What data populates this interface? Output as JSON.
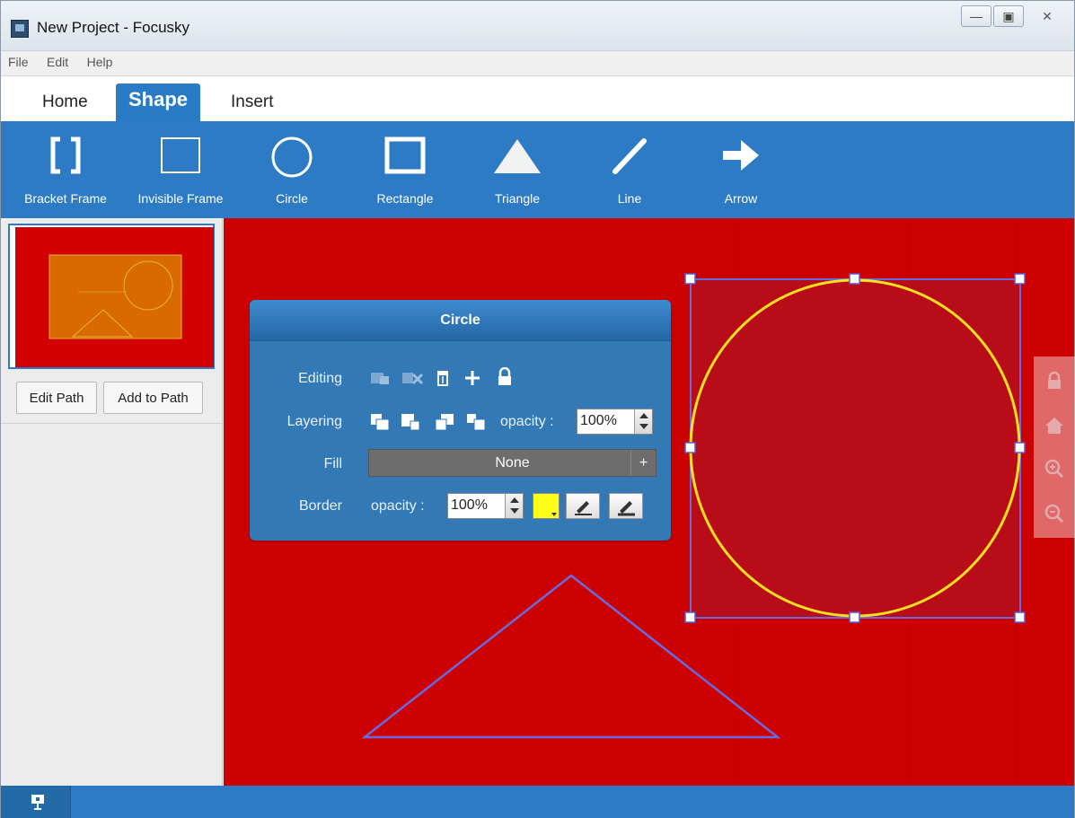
{
  "window": {
    "title": "New Project - Focusky",
    "controls": [
      "minimize-icon",
      "restore-icon",
      "close-icon"
    ]
  },
  "menu": [
    "File",
    "Edit",
    "Help"
  ],
  "tabs": [
    {
      "label": "Home",
      "active": false
    },
    {
      "label": "Shape",
      "active": true
    },
    {
      "label": "Insert",
      "active": false
    }
  ],
  "ribbon": {
    "tools": [
      {
        "label": "Bracket Frame",
        "icon": "bracket-frame-icon"
      },
      {
        "label": "Invisible Frame",
        "icon": "invisible-frame-icon"
      },
      {
        "label": "Circle",
        "icon": "circle-icon"
      },
      {
        "label": "Rectangle",
        "icon": "rectangle-icon"
      },
      {
        "label": "Triangle",
        "icon": "triangle-icon"
      },
      {
        "label": "Line",
        "icon": "line-icon"
      },
      {
        "label": "Arrow",
        "icon": "arrow-icon"
      }
    ]
  },
  "sidebar": {
    "edit_path": "Edit Path",
    "add_to_path": "Add to Path"
  },
  "panel": {
    "title": "Circle",
    "editing_label": "Editing",
    "layering_label": "Layering",
    "fill_label": "Fill",
    "border_label": "Border",
    "opacity_label": "opacity :",
    "layer_opacity": "100%",
    "fill_value": "None",
    "fill_plus": "+",
    "border_opacity": "100%",
    "border_color": "#ffff1a"
  },
  "canvas": {
    "background": "#cc0000",
    "circle_stroke": "#ffe020",
    "selection_color": "#6a6adf"
  },
  "right_rail": [
    "lock-icon",
    "home-icon",
    "zoom-in-icon",
    "zoom-out-icon"
  ]
}
